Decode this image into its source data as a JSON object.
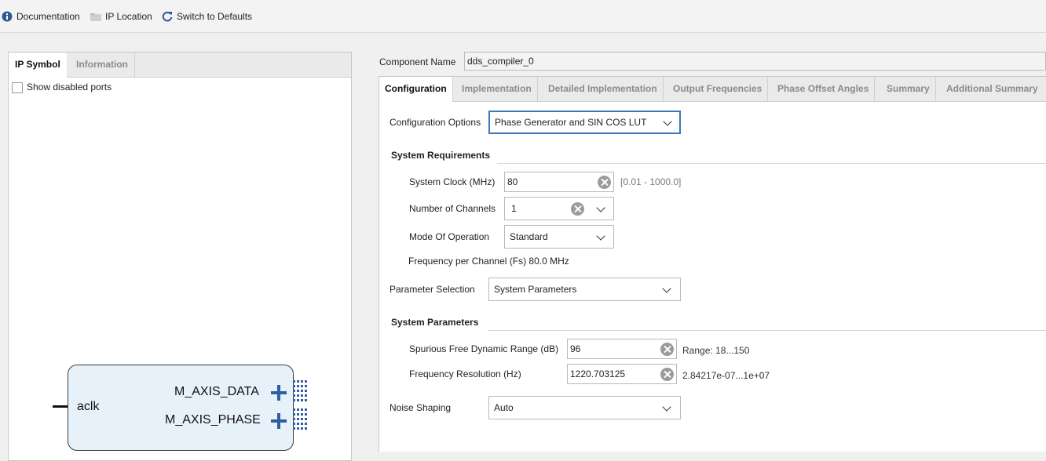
{
  "toolbar": {
    "documentation": "Documentation",
    "ip_location": "IP Location",
    "switch_defaults": "Switch to Defaults"
  },
  "left_panel": {
    "tabs": [
      "IP Symbol",
      "Information"
    ],
    "show_disabled_ports": "Show disabled ports",
    "symbol": {
      "input_port": "aclk",
      "output_ports": [
        "M_AXIS_DATA",
        "M_AXIS_PHASE"
      ]
    }
  },
  "component": {
    "label": "Component Name",
    "value": "dds_compiler_0"
  },
  "right_tabs": [
    "Configuration",
    "Implementation",
    "Detailed Implementation",
    "Output Frequencies",
    "Phase Offset Angles",
    "Summary",
    "Additional Summary"
  ],
  "config": {
    "options_label": "Configuration Options",
    "options_value": "Phase Generator and SIN COS LUT",
    "sys_req_title": "System Requirements",
    "sys_clock_label": "System Clock (MHz)",
    "sys_clock_value": "80",
    "sys_clock_range": "[0.01 - 1000.0]",
    "channels_label": "Number of Channels",
    "channels_value": "1",
    "mode_label": "Mode Of Operation",
    "mode_value": "Standard",
    "freq_per_channel": "Frequency per Channel (Fs) 80.0 MHz",
    "param_sel_label": "Parameter Selection",
    "param_sel_value": "System Parameters",
    "sys_params_title": "System Parameters",
    "sfdr_label": "Spurious Free Dynamic Range (dB)",
    "sfdr_value": "96",
    "sfdr_range": "Range: 18...150",
    "freq_res_label": "Frequency Resolution (Hz)",
    "freq_res_value": "1220.703125",
    "freq_res_range": "2.84217e-07...1e+07",
    "noise_label": "Noise Shaping",
    "noise_value": "Auto"
  }
}
